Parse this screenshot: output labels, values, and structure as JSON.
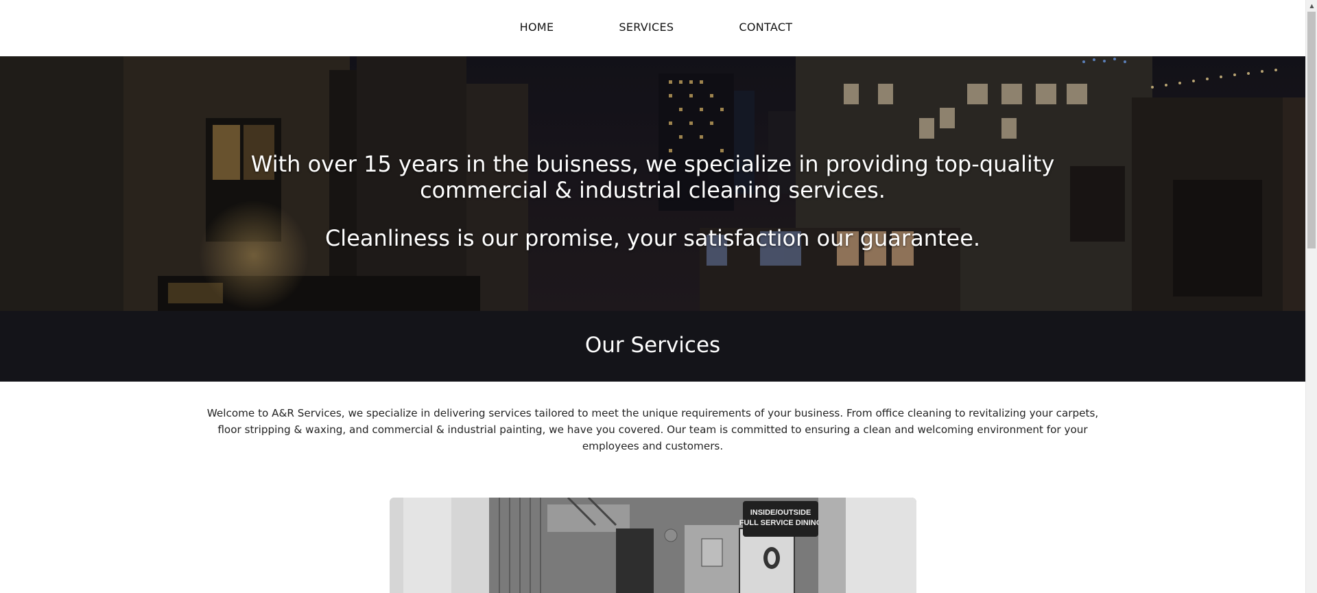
{
  "nav": {
    "items": [
      {
        "label": "HOME"
      },
      {
        "label": "SERVICES"
      },
      {
        "label": "CONTACT"
      }
    ]
  },
  "hero": {
    "line1": "With over 15 years in the buisness, we specialize in providing top-quality commercial & industrial cleaning services.",
    "line2": "Cleanliness is our promise, your satisfaction our guarantee."
  },
  "services": {
    "title": "Our Services",
    "intro": "Welcome to A&R Services, we specialize in delivering services tailored to meet the unique requirements of your business. From office cleaning to revitalizing your carpets, floor stripping & waxing, and commercial & industrial painting, we have you covered. Our team is committed to ensuring a clean and welcoming environment for your employees and customers."
  },
  "photo": {
    "sign_line1": "INSIDE/OUTSIDE",
    "sign_line2": "FULL SERVICE DINING"
  },
  "colors": {
    "services_bar": "#141419",
    "hero_text": "#ffffff",
    "body_text": "#222222"
  }
}
